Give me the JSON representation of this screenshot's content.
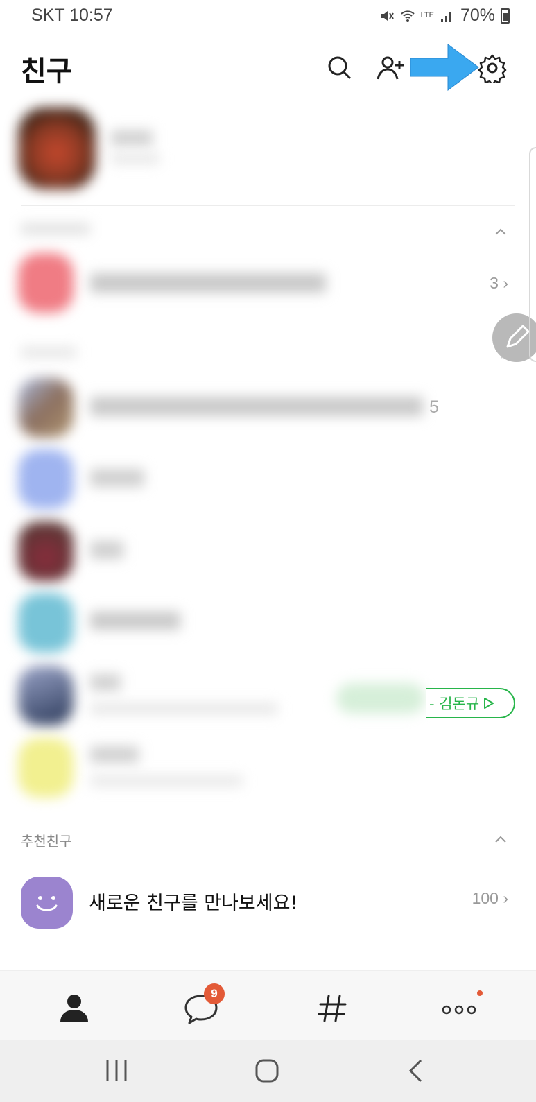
{
  "status_bar": {
    "carrier_time": "SKT 10:57",
    "network": "LTE",
    "battery": "70%"
  },
  "header": {
    "title": "친구",
    "icons": [
      "search-icon",
      "add-friend-icon",
      "settings-icon"
    ]
  },
  "friends": {
    "favorites_count": "3",
    "friends_count": "5",
    "music_status": "- 김돈규"
  },
  "recommended": {
    "label": "추천친구",
    "item_text": "새로운 친구를 만나보세요!",
    "item_count": "100"
  },
  "bottom_nav": {
    "items": [
      "friends-tab",
      "chats-tab",
      "view-tab",
      "more-tab"
    ],
    "chat_badge": "9"
  },
  "colors": {
    "accent_arrow": "#3aa8f0",
    "badge": "#e35a37",
    "music_green": "#27b54a",
    "recommend_purple": "#9b84cf"
  }
}
